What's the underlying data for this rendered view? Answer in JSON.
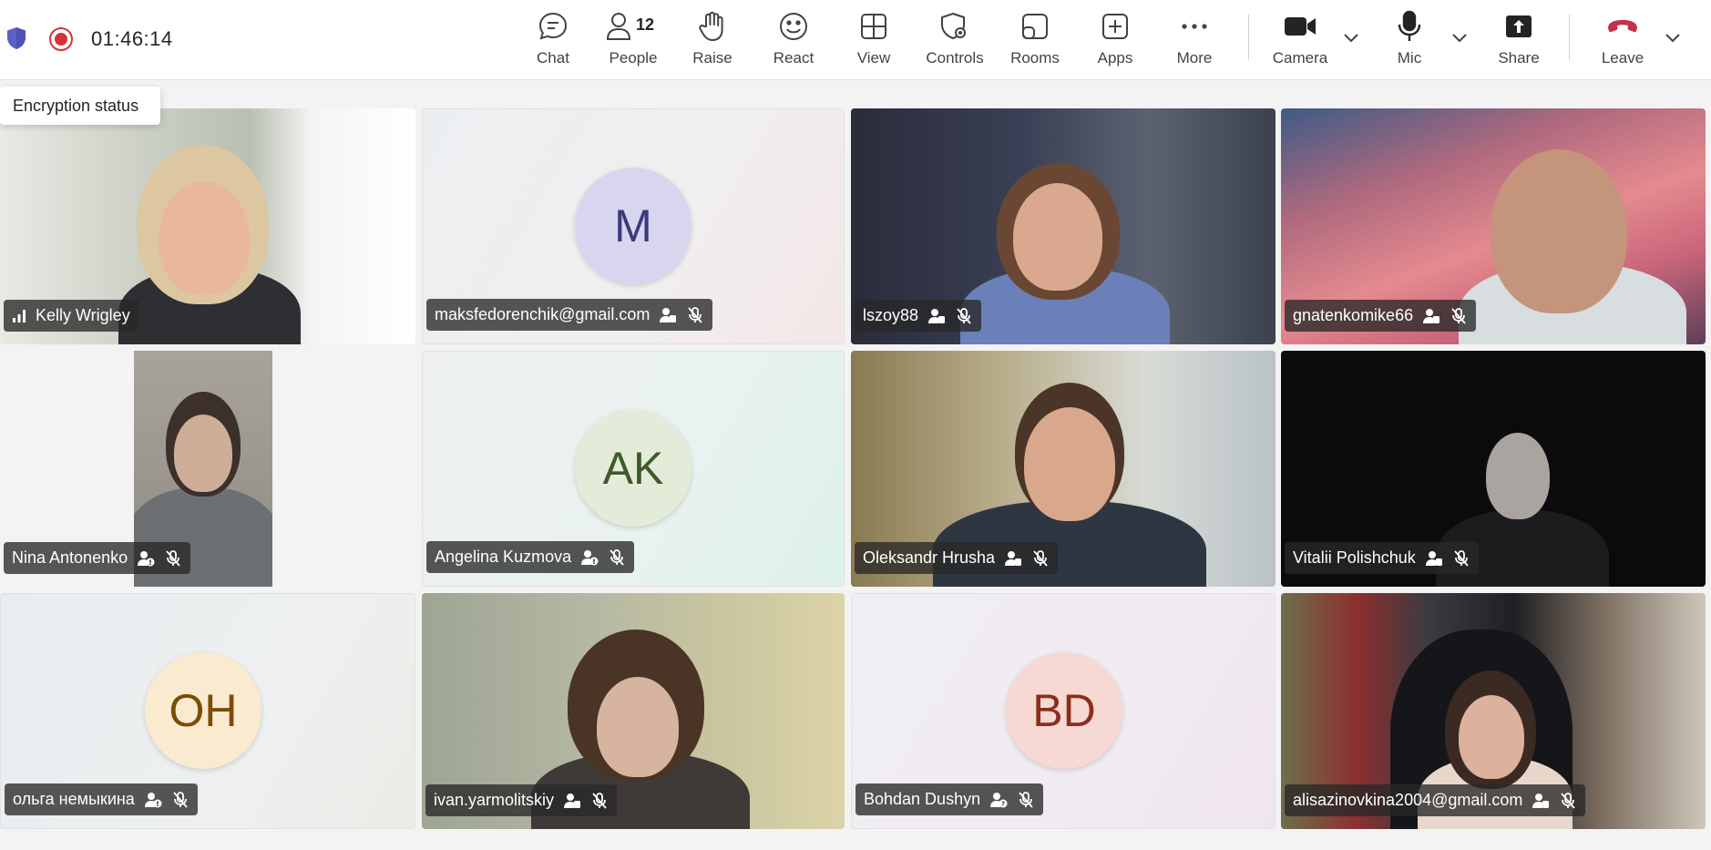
{
  "meeting": {
    "timer": "01:46:14",
    "encryption_tooltip": "Encryption status"
  },
  "toolbar": {
    "chat": "Chat",
    "people": "People",
    "people_count": "12",
    "raise": "Raise",
    "react": "React",
    "view": "View",
    "controls": "Controls",
    "rooms": "Rooms",
    "apps": "Apps",
    "more": "More",
    "camera": "Camera",
    "mic": "Mic",
    "share": "Share",
    "leave": "Leave"
  },
  "colors": {
    "record": "#d13438",
    "leave": "#c4314b",
    "shield": "#5b5fc7"
  },
  "participants": [
    {
      "name": "Kelly Wrigley",
      "type": "video",
      "icons": [
        "signal-icon"
      ]
    },
    {
      "name": "maksfedorenchik@gmail.com",
      "type": "avatar",
      "initials": "M",
      "icons": [
        "external-user-icon",
        "mic-off-icon"
      ]
    },
    {
      "name": "lszoy88",
      "type": "video",
      "icons": [
        "external-user-icon",
        "mic-off-icon"
      ]
    },
    {
      "name": "gnatenkomike66",
      "type": "video",
      "icons": [
        "external-user-icon",
        "mic-off-icon"
      ]
    },
    {
      "name": "Nina Antonenko",
      "type": "video",
      "icons": [
        "unverified-user-icon",
        "mic-off-icon"
      ]
    },
    {
      "name": "Angelina Kuzmova",
      "type": "avatar",
      "initials": "AK",
      "icons": [
        "unverified-user-icon",
        "mic-off-icon"
      ]
    },
    {
      "name": "Oleksandr Hrusha",
      "type": "video",
      "icons": [
        "external-user-icon",
        "mic-off-icon"
      ]
    },
    {
      "name": "Vitalii Polishchuk",
      "type": "video",
      "icons": [
        "external-user-icon",
        "mic-off-icon"
      ]
    },
    {
      "name": "ольга немыкина",
      "type": "avatar",
      "initials": "OH",
      "icons": [
        "unverified-user-icon",
        "mic-off-icon"
      ]
    },
    {
      "name": "ivan.yarmolitskiy",
      "type": "video",
      "icons": [
        "external-user-icon",
        "mic-off-icon"
      ]
    },
    {
      "name": "Bohdan Dushyn",
      "type": "avatar",
      "initials": "BD",
      "icons": [
        "unknown-user-icon",
        "mic-off-icon"
      ]
    },
    {
      "name": "alisazinovkina2004@gmail.com",
      "type": "video",
      "icons": [
        "external-user-icon",
        "mic-off-icon"
      ]
    }
  ]
}
